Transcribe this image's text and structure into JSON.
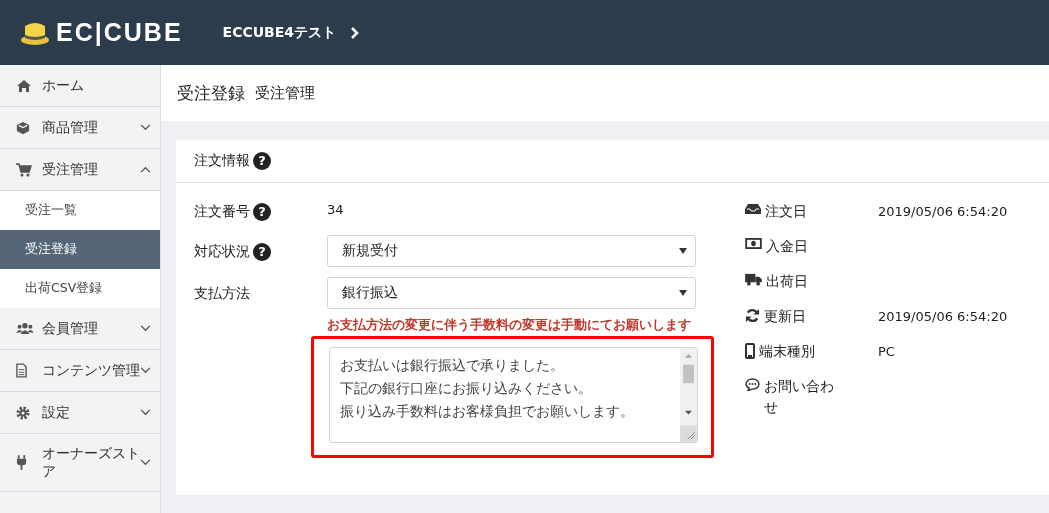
{
  "header": {
    "logo": "EC|CUBE",
    "shop_name": "ECCUBE4テスト"
  },
  "sidebar": {
    "items": [
      {
        "label": "ホーム",
        "selected": false
      },
      {
        "label": "商品管理",
        "expanded": false,
        "selected": false
      },
      {
        "label": "受注管理",
        "expanded": true,
        "selected": false,
        "children": [
          {
            "label": "受注一覧",
            "selected": false
          },
          {
            "label": "受注登録",
            "selected": true
          },
          {
            "label": "出荷CSV登録",
            "selected": false
          }
        ]
      },
      {
        "label": "会員管理",
        "expanded": false,
        "selected": false
      },
      {
        "label": "コンテンツ管理",
        "expanded": false,
        "selected": false
      },
      {
        "label": "設定",
        "expanded": false,
        "selected": false
      },
      {
        "label": "オーナーズストア",
        "expanded": false,
        "selected": false
      }
    ]
  },
  "page_title": {
    "title": "受注登録",
    "subtitle": "受注管理"
  },
  "card": {
    "title": "注文情報",
    "help": "?",
    "fields": [
      {
        "kind": "text",
        "label": "注文番号",
        "help": "?",
        "value": "34"
      },
      {
        "kind": "select",
        "label": "対応状況",
        "help": "?",
        "value": "新規受付"
      },
      {
        "kind": "select",
        "label": "支払方法",
        "value": "銀行振込",
        "warning": "お支払方法の変更に伴う手数料の変更は手動にてお願いします"
      }
    ],
    "message": {
      "lines": [
        "お支払いは銀行振込で承りました。",
        "下記の銀行口座にお振り込みください。",
        "振り込み手数料はお客様負担でお願いします。"
      ],
      "highlighted": true
    },
    "info": [
      {
        "label": "注文日",
        "value": "2019/05/06 6:54:20"
      },
      {
        "label": "入金日"
      },
      {
        "label": "出荷日"
      },
      {
        "label": "更新日",
        "value": "2019/05/06 6:54:20"
      },
      {
        "label": "端末種別",
        "value": "PC"
      },
      {
        "label": "お問い合わせ"
      }
    ]
  }
}
